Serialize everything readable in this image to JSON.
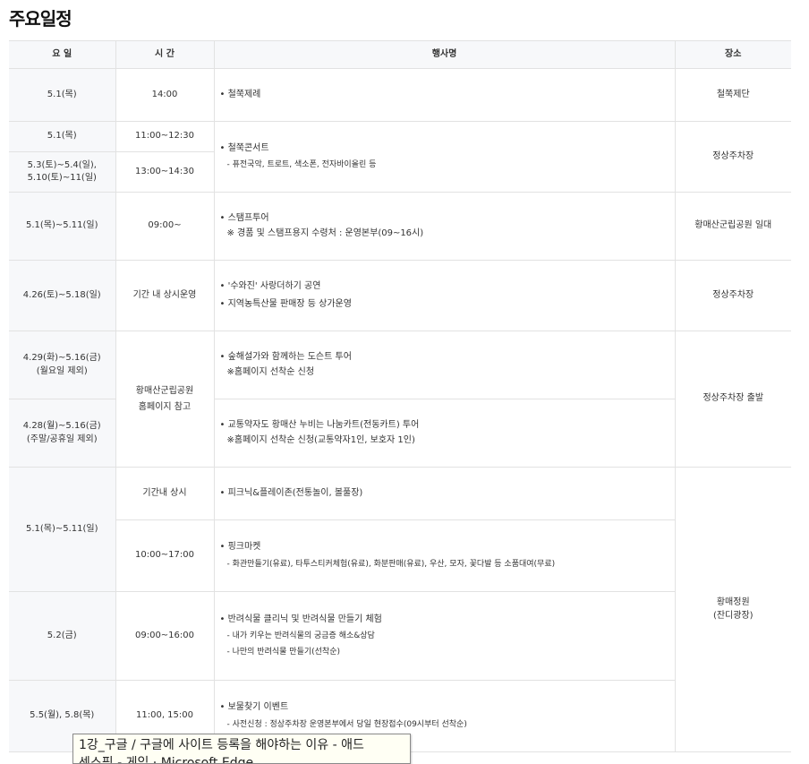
{
  "page": {
    "title": "주요일정"
  },
  "table": {
    "headers": {
      "day": "요 일",
      "time": "시 간",
      "event": "행사명",
      "place": "장소"
    },
    "days": [
      "5.1(목)",
      "5.1(목)",
      "5.3(토)~5.4(일),\n5.10(토)~11(일)",
      "5.1(목)~5.11(일)",
      "4.26(토)~5.18(일)",
      "4.29(화)~5.16(금)\n(월요일 제외)",
      "4.28(월)~5.16(금)\n(주말/공휴일 제외)",
      "5.1(목)~5.11(일)",
      "5.2(금)",
      "5.5(월), 5.8(목)"
    ],
    "times": [
      "14:00",
      "11:00~12:30",
      "13:00~14:30",
      "09:00~",
      "기간 내 상시운영",
      "황매산군립공원\n홈페이지 참고",
      "기간내 상시",
      "10:00~17:00",
      "09:00~16:00",
      "11:00, 15:00"
    ],
    "events": [
      [
        "• 철쭉제례"
      ],
      [
        "• 철쭉콘서트",
        "- 퓨전국악, 트로트, 색소폰, 전자바이올린 등"
      ],
      [
        "• 스탬프투어",
        "※ 경품 및 스탬프용지 수령처 : 운영본부(09~16시)"
      ],
      [
        "• '수와진' 사랑더하기 공연",
        "• 지역농특산물 판매장 등 상가운영"
      ],
      [
        "• 숲해설가와 함께하는 도슨트 투어",
        "※홈페이지 선착순 신청"
      ],
      [
        "• 교통약자도 황매산 누비는 나눔카트(전동카트) 투어",
        "※홈페이지 선착순 신청(교통약자1인, 보호자 1인)"
      ],
      [
        "• 피크닉&플레이존(전통놀이, 볼풀장)"
      ],
      [
        "• 핑크마켓",
        "- 화관만들기(유료), 타투스티커체험(유료), 화분판매(유료), 우산, 모자, 꽃다발 등 소품대여(무료)"
      ],
      [
        "• 반려식물 클리닉 및 반려식물 만들기 체험",
        "- 내가 키우는 반려식물의 궁금증 해소&상담",
        "- 나만의 반려식물 만들기(선착순)"
      ],
      [
        "• 보물찾기 이벤트",
        "- 사전신청 : 정상주차장 운영본부에서 당일 현장접수(09시부터 선착순)"
      ]
    ],
    "places": [
      "철쭉제단",
      "정상주차장",
      "황매산군립공원 일대",
      "정상주차장",
      "정상주차장 출발",
      "황매정원\n(잔디광장)"
    ]
  },
  "tooltip": {
    "line1": "1강_구글 / 구글에 사이트 등록을 해야하는 이유 - 애드",
    "line2": "센스픽 - 게임 · Microsoft Edge"
  }
}
